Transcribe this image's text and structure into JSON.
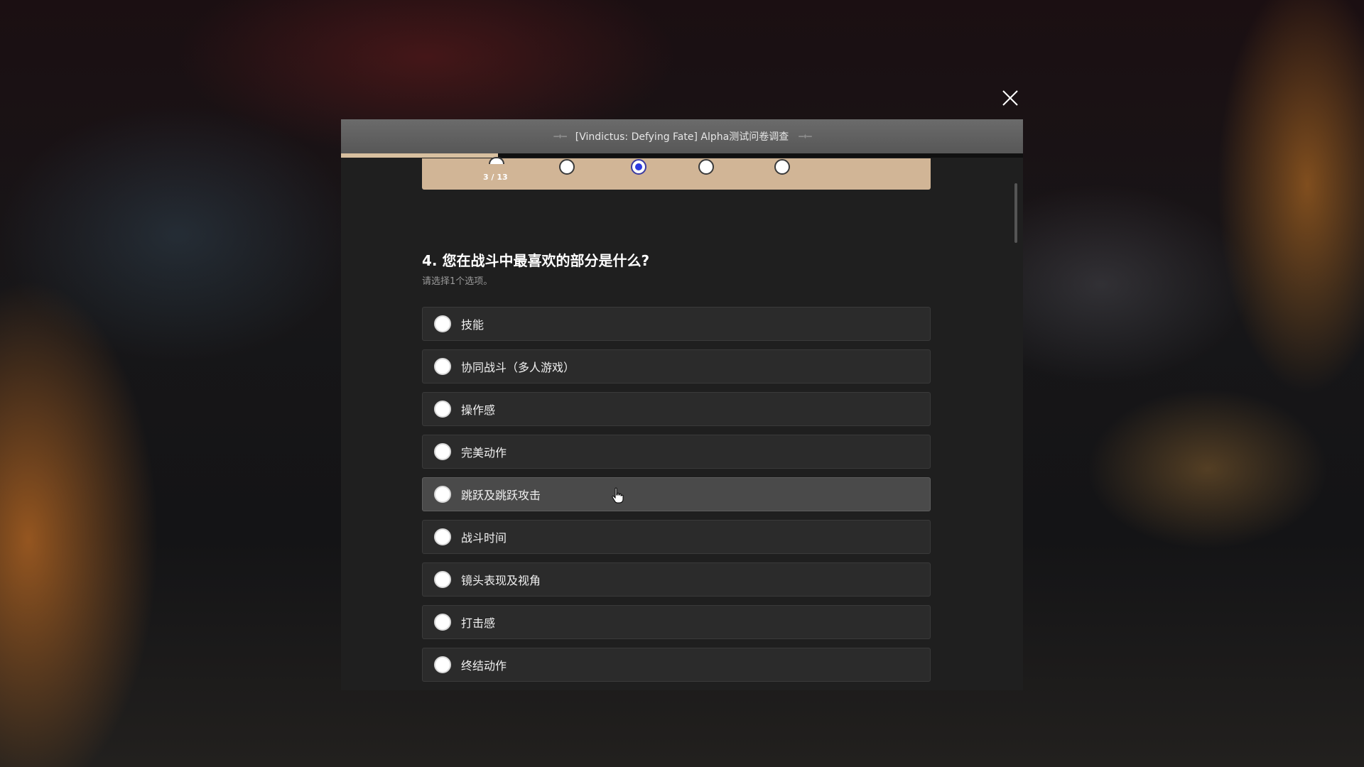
{
  "window": {
    "title": "[Vindictus: Defying Fate] Alpha测试问卷调查",
    "close_icon": "close-icon"
  },
  "progress": {
    "fraction": 0.23
  },
  "rating_scale": {
    "page_indicator": "3 / 13",
    "options_count": 5,
    "selected_index": 2
  },
  "question": {
    "title": "4. 您在战斗中最喜欢的部分是什么?",
    "hint": "请选择1个选项。",
    "options": [
      {
        "label": "技能"
      },
      {
        "label": "协同战斗（多人游戏）"
      },
      {
        "label": "操作感"
      },
      {
        "label": "完美动作"
      },
      {
        "label": "跳跃及跳跃攻击"
      },
      {
        "label": "战斗时间"
      },
      {
        "label": "镜头表现及视角"
      },
      {
        "label": "打击感"
      },
      {
        "label": "终结动作"
      }
    ],
    "hovered_index": 4
  },
  "colors": {
    "accent_rating_bar": "#d1b596",
    "selected_dot": "#2c3ae0",
    "modal_bg": "#1f1f1f",
    "option_bg": "#2b2b2b"
  }
}
